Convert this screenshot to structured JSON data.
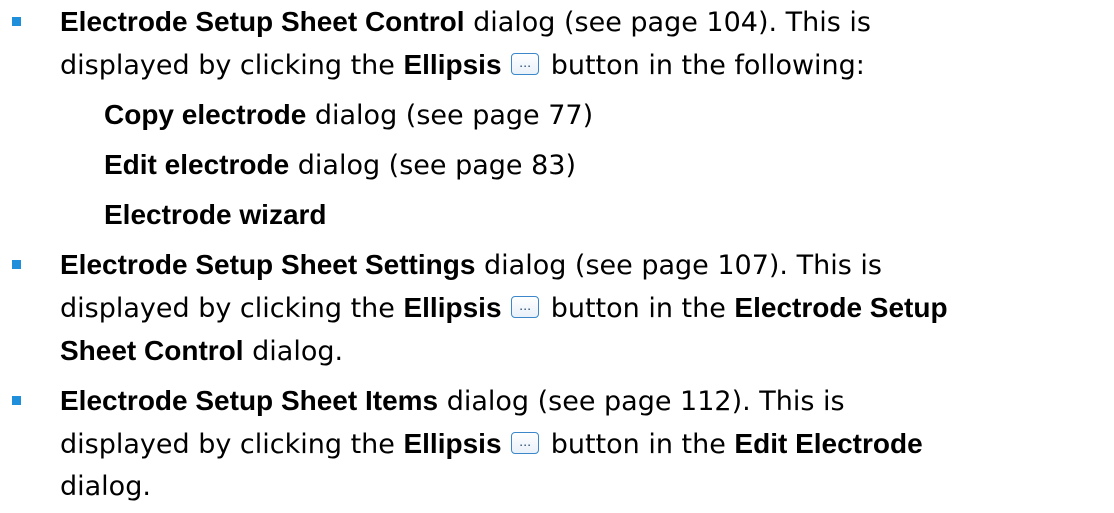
{
  "ellipsis_button": {
    "glyph": "…",
    "color": "#3c87c9"
  },
  "bullet_color": "#1f8fdc",
  "items": [
    {
      "title": "Electrode Setup Sheet Control",
      "text1": " dialog (see page 104). This is",
      "text2_prefix": "displayed by clicking the ",
      "ellipsis_label": "Ellipsis",
      "text2_suffix": " button in the following:",
      "subitems": [
        {
          "bold": "Copy electrode",
          "text": " dialog (see page 77)"
        },
        {
          "bold": "Edit electrode",
          "text": " dialog (see page 83)"
        },
        {
          "bold": "Electrode wizard",
          "text": ""
        }
      ]
    },
    {
      "title": "Electrode Setup Sheet Settings",
      "text1": " dialog (see page 107). This is",
      "text2_prefix": "displayed by clicking the ",
      "ellipsis_label": "Ellipsis",
      "text2_mid": " button in the ",
      "target_bold_line2": "Electrode Setup",
      "target_bold_line3": "Sheet Control",
      "text3_suffix": " dialog."
    },
    {
      "title": "Electrode Setup Sheet Items",
      "text1": " dialog (see page 112). This is",
      "text2_prefix": "displayed by clicking the ",
      "ellipsis_label": "Ellipsis",
      "text2_mid": " button in the ",
      "target_bold": "Edit Electrode",
      "text3": "dialog."
    }
  ]
}
